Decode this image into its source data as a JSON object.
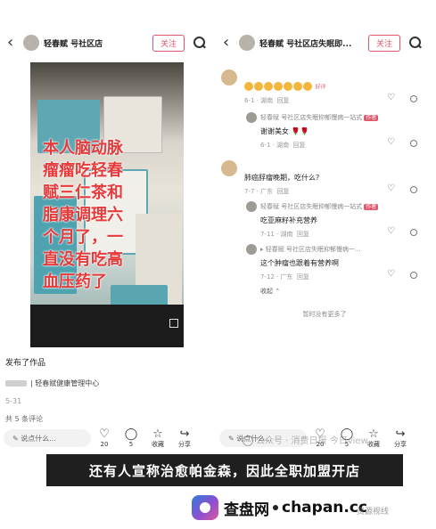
{
  "left_panel": {
    "shop_name": "轻春赋",
    "shop_name_suffix": "号社区店",
    "follow_label": "关注",
    "video_overlay_lines": [
      "本人脑动脉",
      "瘤瘤吃轻春",
      "赋三仁茶和",
      "脂康调理六",
      "个月了，一",
      "直没有吃高",
      "血压药了"
    ],
    "published_label": "发布了作品",
    "location_text": "| 轻春赋健康管理中心",
    "date": "5-31",
    "comment_count": "共 5 条评论",
    "input_placeholder": "说点什么...",
    "actions": [
      {
        "icon": "heart-icon",
        "label": "20"
      },
      {
        "icon": "comment-icon",
        "label": "5"
      },
      {
        "icon": "star-icon",
        "label": "收藏"
      },
      {
        "icon": "share-icon",
        "label": "分享"
      }
    ]
  },
  "right_panel": {
    "shop_name": "轻春赋",
    "shop_name_suffix": "号社区店失眠即...",
    "follow_label": "关注",
    "comments": [
      {
        "name": "",
        "text": "",
        "meta": "6-1 · 湖南",
        "reply": "回复",
        "badge": "好评"
      },
      {
        "name": "轻春赋    号社区店失眠抑郁慢病一站式",
        "tag": "作者",
        "text": "谢谢美女",
        "meta": "6-1 · 湖南",
        "reply": "回复"
      },
      {
        "name": "",
        "text": "肺癌脬瘤晚期，吃什么?",
        "meta": "7-7 · 广东",
        "reply": "回复"
      },
      {
        "name": "轻春赋    号社区店失眠抑郁慢病一站式",
        "tag": "作者",
        "text": "吃亚麻籽补充营养",
        "meta": "7-11 · 湖南",
        "reply": "回复"
      },
      {
        "name": "▸ 轻春赋    号社区店失眠抑郁慢病一...",
        "text": "这个肿瘤也跟着有营养啊",
        "meta": "7-12 · 广东",
        "reply": "回复"
      }
    ],
    "collapse_label": "收起",
    "end_text": "暂时没有更多了",
    "input_placeholder": "说点什么...",
    "actions": [
      {
        "icon": "heart-icon",
        "label": "20"
      },
      {
        "icon": "comment-icon",
        "label": "5"
      },
      {
        "icon": "star-icon",
        "label": "收藏"
      },
      {
        "icon": "share-icon",
        "label": "分享"
      }
    ]
  },
  "caption_banner": "还有人宣称治愈帕金森，因此全职加盟开店",
  "watermark": "公众号 · 消费日报 今日view",
  "brand": {
    "name_cn": "查盘网",
    "name_en": "chapan.cc",
    "source_mark": "资源视线"
  }
}
